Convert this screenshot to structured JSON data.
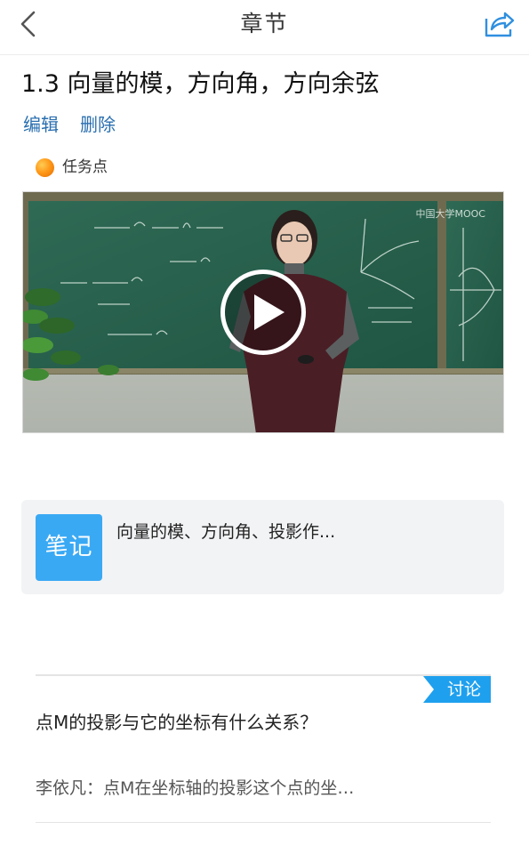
{
  "navbar": {
    "title": "章节",
    "back_icon": "chevron-left-icon",
    "share_icon": "share-icon",
    "accent_color": "#2f8fdf"
  },
  "chapter": {
    "title": "1.3 向量的模，方向角，方向余弦",
    "edit_label": "编辑",
    "delete_label": "删除",
    "task_point_label": "任务点"
  },
  "video": {
    "watermark": "中国大学MOOC",
    "play_icon": "play-icon"
  },
  "note": {
    "badge": "笔记",
    "text": "向量的模、方向角、投影作..."
  },
  "discussion": {
    "tag": "讨论",
    "question": "点M的投影与它的坐标有什么关系？",
    "reply": "李依凡：点M在坐标轴的投影这个点的坐…"
  }
}
